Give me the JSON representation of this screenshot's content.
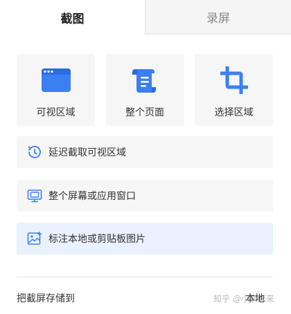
{
  "tabs": [
    {
      "label": "截图",
      "active": true
    },
    {
      "label": "录屏",
      "active": false
    }
  ],
  "cards": [
    {
      "label": "可视区域",
      "icon": "browser-window-icon"
    },
    {
      "label": "整个页面",
      "icon": "scroll-page-icon"
    },
    {
      "label": "选择区域",
      "icon": "crop-icon"
    }
  ],
  "options": [
    {
      "label": "延迟截取可视区域",
      "icon": "delay-timer-icon"
    },
    {
      "label": "整个屏幕或应用窗口",
      "icon": "monitor-window-icon"
    },
    {
      "label": "标注本地或剪贴板图片",
      "icon": "image-annotate-icon",
      "selected": true
    }
  ],
  "footer": {
    "label": "把截屏存储到",
    "value": "本地"
  },
  "watermark": "知乎 @小鹏起来",
  "colors": {
    "accent": "#3b7ff4",
    "selected_bg": "#e9f2fe",
    "card_bg": "#f6f6f6"
  }
}
